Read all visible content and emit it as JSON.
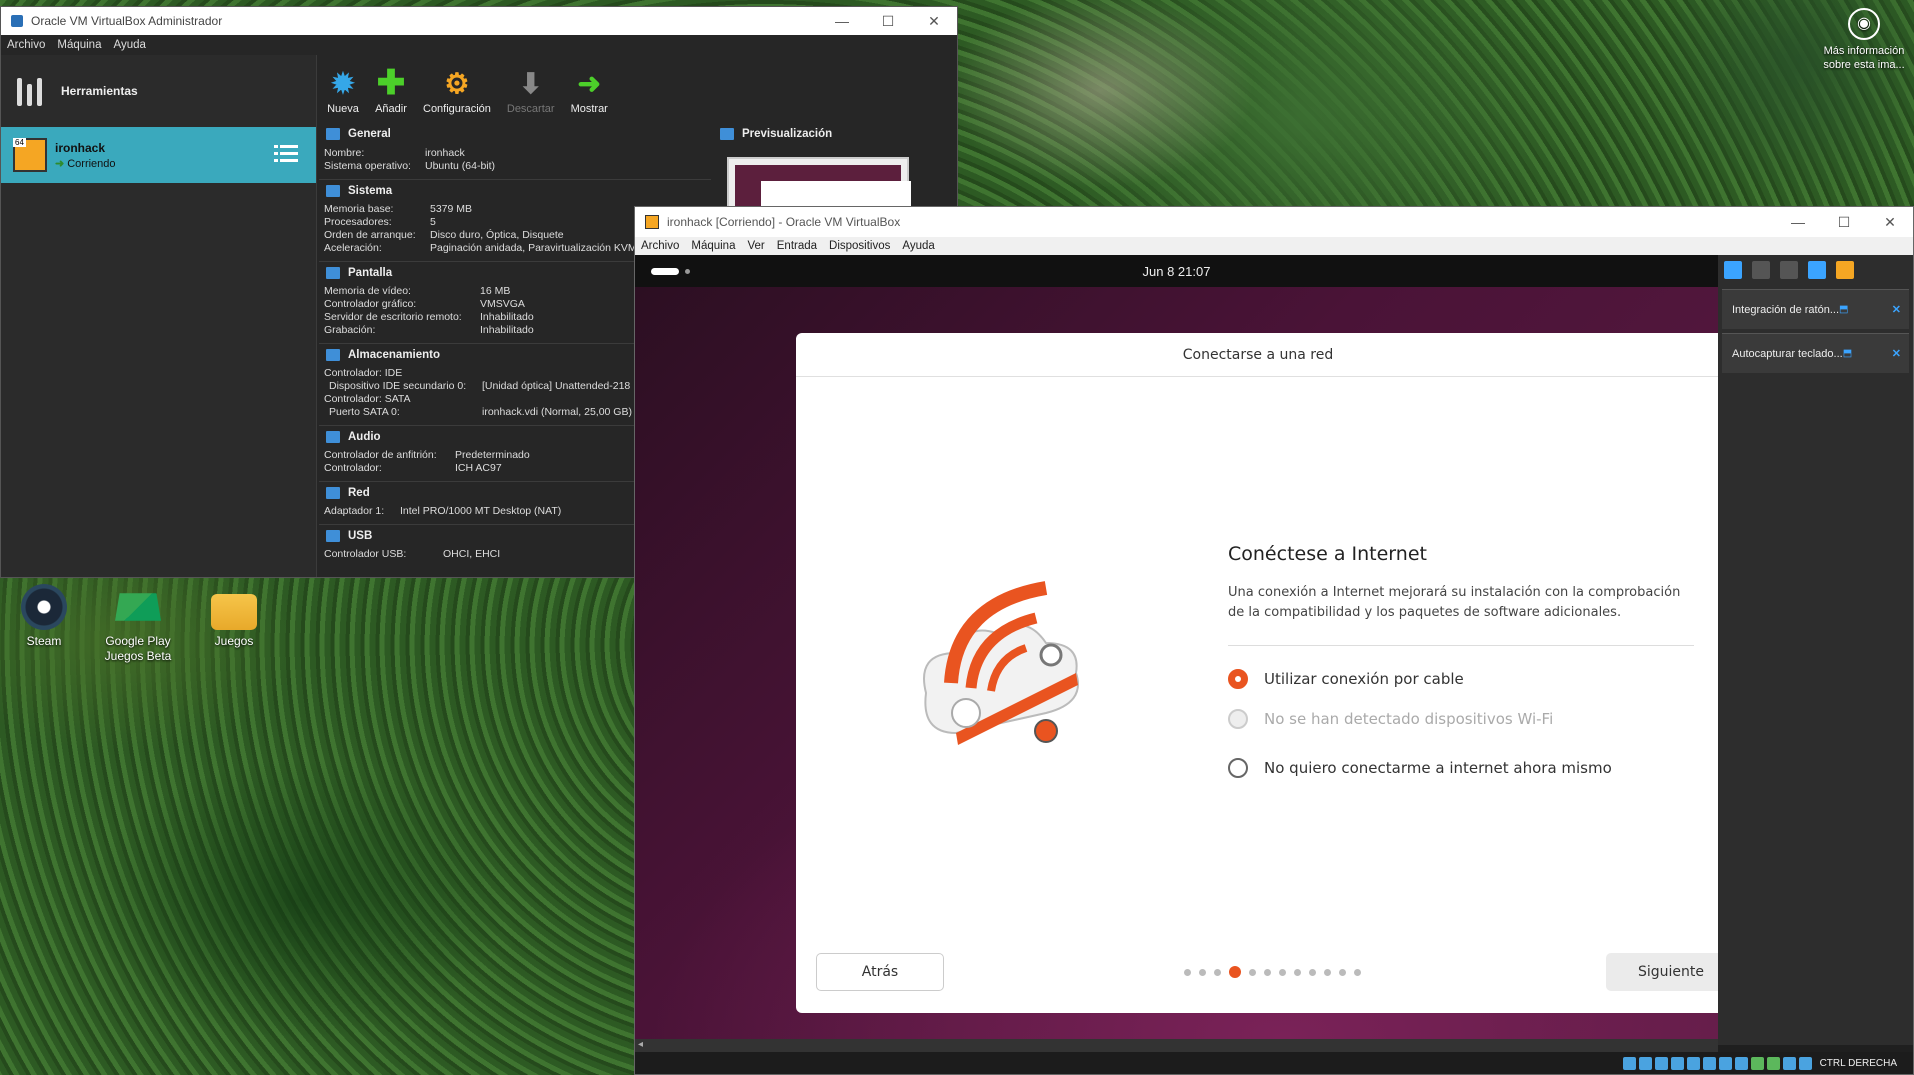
{
  "desktop": {
    "info_widget_label": "Más información sobre esta ima...",
    "icons": [
      {
        "label": "Steam"
      },
      {
        "label": "Google Play Juegos Beta"
      },
      {
        "label": "Juegos"
      }
    ]
  },
  "manager": {
    "title": "Oracle VM VirtualBox Administrador",
    "menu": [
      "Archivo",
      "Máquina",
      "Ayuda"
    ],
    "tools_label": "Herramientas",
    "vm": {
      "name": "ironhack",
      "state": "Corriendo"
    },
    "toolbar": [
      {
        "label": "Nueva",
        "icon": "starburst-icon",
        "enabled": true
      },
      {
        "label": "Añadir",
        "icon": "plus-icon",
        "enabled": true
      },
      {
        "label": "Configuración",
        "icon": "gear-icon",
        "enabled": true
      },
      {
        "label": "Descartar",
        "icon": "arrow-down-icon",
        "enabled": false
      },
      {
        "label": "Mostrar",
        "icon": "arrow-right-icon",
        "enabled": true
      }
    ],
    "sections": {
      "general": {
        "title": "General",
        "rows": [
          [
            "Nombre:",
            "ironhack"
          ],
          [
            "Sistema operativo:",
            "Ubuntu (64-bit)"
          ]
        ]
      },
      "sistema": {
        "title": "Sistema",
        "rows": [
          [
            "Memoria base:",
            "5379 MB"
          ],
          [
            "Procesadores:",
            "5"
          ],
          [
            "Orden de arranque:",
            "Disco duro, Óptica, Disquete"
          ],
          [
            "Aceleración:",
            "Paginación anidada, Paravirtualización KVM"
          ]
        ]
      },
      "pantalla": {
        "title": "Pantalla",
        "rows": [
          [
            "Memoria de vídeo:",
            "16 MB"
          ],
          [
            "Controlador gráfico:",
            "VMSVGA"
          ],
          [
            "Servidor de escritorio remoto:",
            "Inhabilitado"
          ],
          [
            "Grabación:",
            "Inhabilitado"
          ]
        ]
      },
      "almacenamiento": {
        "title": "Almacenamiento",
        "rows": [
          [
            "Controlador: IDE",
            ""
          ],
          [
            " Dispositivo IDE secundario 0:",
            "[Unidad óptica] Unattended-218"
          ],
          [
            "Controlador: SATA",
            ""
          ],
          [
            " Puerto SATA 0:",
            "ironhack.vdi (Normal, 25,00 GB)"
          ]
        ]
      },
      "audio": {
        "title": "Audio",
        "rows": [
          [
            "Controlador de anfitrión:",
            "Predeterminado"
          ],
          [
            "Controlador:",
            "ICH AC97"
          ]
        ]
      },
      "red": {
        "title": "Red",
        "rows": [
          [
            "Adaptador 1:",
            "Intel PRO/1000 MT Desktop (NAT)"
          ]
        ]
      },
      "usb": {
        "title": "USB",
        "rows": [
          [
            "Controlador USB:",
            "OHCI, EHCI"
          ]
        ]
      }
    },
    "preview_title": "Previsualización"
  },
  "vmwin": {
    "title": "ironhack [Corriendo] - Oracle VM VirtualBox",
    "menu": [
      "Archivo",
      "Máquina",
      "Ver",
      "Entrada",
      "Dispositivos",
      "Ayuda"
    ],
    "clock": "Jun 8  21:07",
    "dialog": {
      "title": "Conectarse a una red",
      "heading": "Conéctese a Internet",
      "description": "Una conexión a Internet mejorará su instalación con la comprobación de la compatibilidad y los paquetes de software adicionales.",
      "options": [
        {
          "label": "Utilizar conexión por cable",
          "selected": true,
          "disabled": false
        },
        {
          "label": "No se han detectado dispositivos Wi-Fi",
          "selected": false,
          "disabled": true
        },
        {
          "label": "No quiero conectarme a internet ahora mismo",
          "selected": false,
          "disabled": false
        }
      ],
      "back_label": "Atrás",
      "next_label": "Siguiente",
      "step_current": 4,
      "step_total": 12
    },
    "notifications": [
      {
        "label": "Integración de ratón..."
      },
      {
        "label": "Autocapturar teclado..."
      }
    ],
    "host_key": "CTRL DERECHA"
  },
  "colors": {
    "ubuntu_orange": "#e95420",
    "vbox_selection": "#3aa9bd"
  }
}
